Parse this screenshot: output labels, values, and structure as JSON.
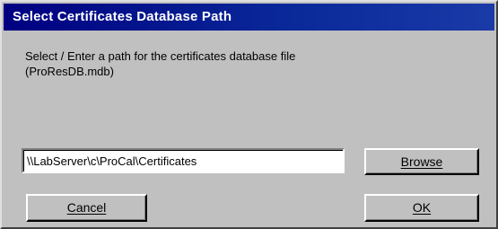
{
  "dialog": {
    "title": "Select Certificates Database Path",
    "prompt": "Select / Enter a path for the certificates database file\n(ProResDB.mdb)",
    "path_value": "\\\\LabServer\\c\\ProCal\\Certificates"
  },
  "buttons": {
    "browse": "Browse",
    "cancel": "Cancel",
    "ok": "OK"
  },
  "colors": {
    "titlebar": "#000080",
    "face": "#c0c0c0"
  }
}
